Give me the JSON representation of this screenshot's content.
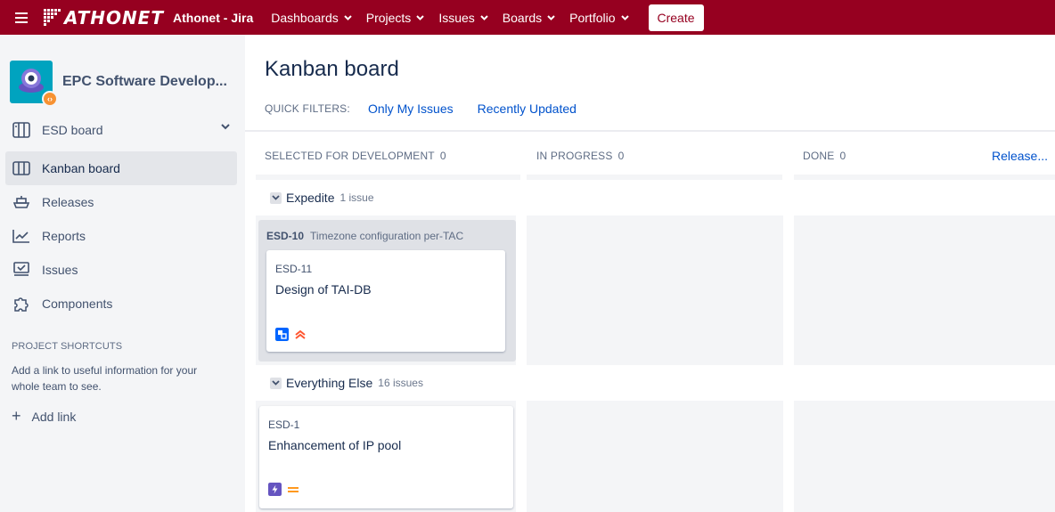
{
  "topbar": {
    "logo_text": "ATHONET",
    "app_title": "Athonet - Jira",
    "nav": [
      "Dashboards",
      "Projects",
      "Issues",
      "Boards",
      "Portfolio"
    ],
    "create_label": "Create"
  },
  "sidebar": {
    "project_name": "EPC Software Develop...",
    "items": [
      {
        "label": "ESD board",
        "icon": "board-icon"
      },
      {
        "label": "Kanban board",
        "icon": "columns-icon"
      },
      {
        "label": "Releases",
        "icon": "ship-icon"
      },
      {
        "label": "Reports",
        "icon": "chart-icon"
      },
      {
        "label": "Issues",
        "icon": "issues-icon"
      },
      {
        "label": "Components",
        "icon": "puzzle-icon"
      }
    ],
    "shortcuts_title": "PROJECT SHORTCUTS",
    "shortcuts_help": "Add a link to useful information for your whole team to see.",
    "add_link": "Add link"
  },
  "main": {
    "title": "Kanban board",
    "quick_filters_label": "QUICK FILTERS:",
    "filters": [
      "Only My Issues",
      "Recently Updated"
    ],
    "columns": [
      {
        "name": "SELECTED FOR DEVELOPMENT",
        "count": "0"
      },
      {
        "name": "IN PROGRESS",
        "count": "0"
      },
      {
        "name": "DONE",
        "count": "0"
      }
    ],
    "release_link": "Release...",
    "swimlanes": [
      {
        "name": "Expedite",
        "issues": "1 issue"
      },
      {
        "name": "Everything Else",
        "issues": "16 issues"
      }
    ],
    "parent": {
      "key": "ESD-10",
      "summary": "Timezone configuration per-TAC"
    },
    "cards": [
      {
        "key": "ESD-11",
        "summary": "Design of TAI-DB",
        "type_color": "#0065ff",
        "priority": "highest",
        "priority_color": "#ff5630"
      },
      {
        "key": "ESD-1",
        "summary": "Enhancement of IP pool",
        "type_color": "#6554c0",
        "priority": "medium",
        "priority_color": "#ff991f"
      }
    ]
  },
  "colors": {
    "brand": "#960020",
    "link": "#0052cc",
    "sidebar_bg": "#f4f5f7"
  }
}
